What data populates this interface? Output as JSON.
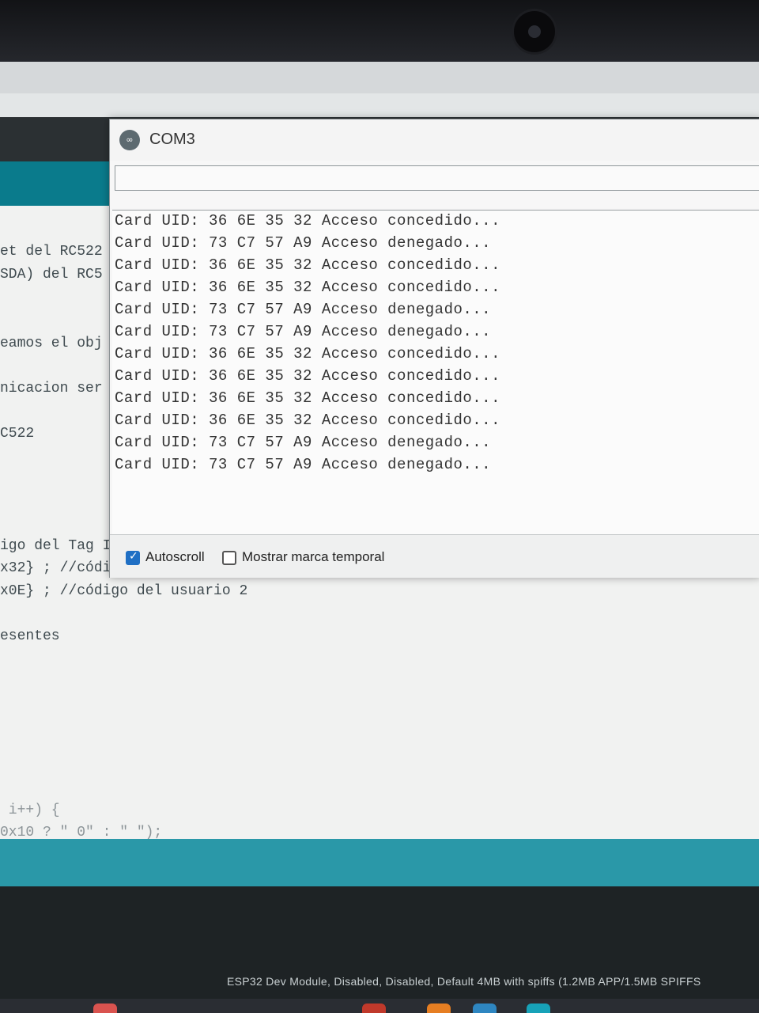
{
  "serial_monitor": {
    "title": "COM3",
    "logo": "arduino-logo-icon",
    "send_input_value": "",
    "output_lines": [
      "Card UID: 36 6E 35 32 Acceso concedido...",
      "Card UID: 73 C7 57 A9 Acceso denegado...",
      "Card UID: 36 6E 35 32 Acceso concedido...",
      "Card UID: 36 6E 35 32 Acceso concedido...",
      "Card UID: 73 C7 57 A9 Acceso denegado...",
      "Card UID: 73 C7 57 A9 Acceso denegado...",
      "Card UID: 36 6E 35 32 Acceso concedido...",
      "Card UID: 36 6E 35 32 Acceso concedido...",
      "Card UID: 36 6E 35 32 Acceso concedido...",
      "Card UID: 36 6E 35 32 Acceso concedido...",
      "Card UID: 73 C7 57 A9 Acceso denegado...",
      "Card UID: 73 C7 57 A9 Acceso denegado..."
    ],
    "autoscroll_label": "Autoscroll",
    "autoscroll_checked": true,
    "timestamp_label": "Mostrar marca temporal",
    "timestamp_checked": false
  },
  "editor": {
    "visible_code_fragments": [
      "et del RC522",
      "SDA) del RC5",
      "eamos el obj",
      "nicacion ser",
      "C522",
      "igo del Tag I",
      "x32} ; //códi",
      "x0E} ; //código del usuario 2",
      "esentes",
      " i++) {",
      "0x10 ? \" 0\" : \" \");"
    ]
  },
  "status_bar": {
    "board_text": "ESP32 Dev Module, Disabled, Disabled, Default 4MB with spiffs (1.2MB APP/1.5MB SPIFFS"
  },
  "colors": {
    "ide_teal": "#0a7b8c",
    "checkbox_blue": "#1f6fc4"
  }
}
